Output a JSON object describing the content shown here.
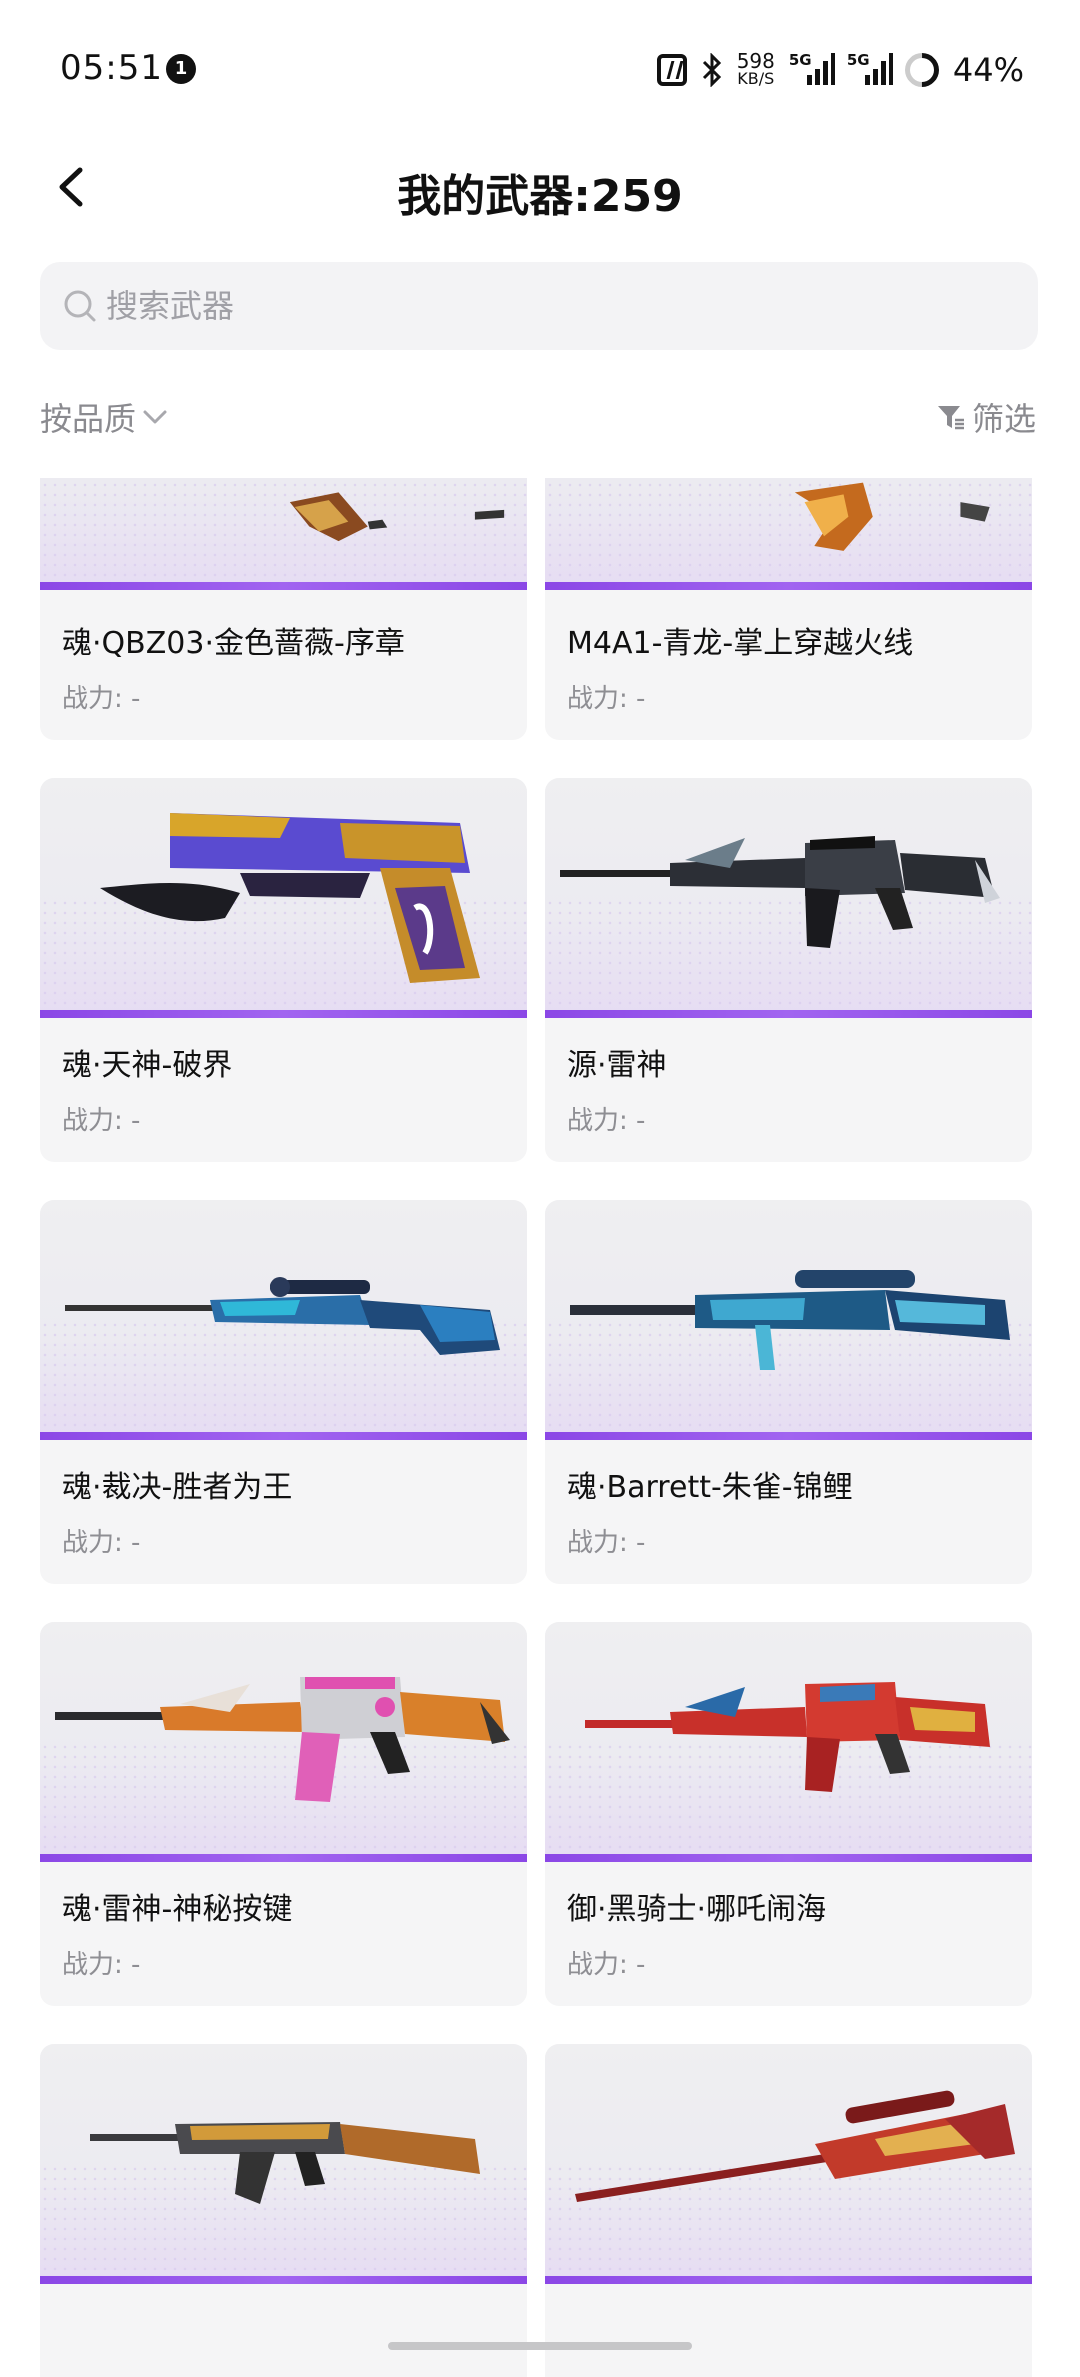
{
  "status_bar": {
    "time": "05:51",
    "notification_count": "1",
    "net_speed_value": "598",
    "net_speed_unit": "KB/S",
    "signal_1_label": "5G",
    "signal_2_label": "5G",
    "battery": "44%"
  },
  "header": {
    "title": "我的武器:259"
  },
  "search": {
    "placeholder": "搜索武器"
  },
  "filters": {
    "sort_label": "按品质",
    "filter_label": "筛选"
  },
  "weapons": [
    {
      "name": "魂·QBZ03·金色蔷薇-序章",
      "power": "战力: -",
      "icon": "rifle-gold-rose"
    },
    {
      "name": "M4A1-青龙-掌上穿越火线",
      "power": "战力: -",
      "icon": "rifle-azure-dragon"
    },
    {
      "name": "魂·天神-破界",
      "power": "战力: -",
      "icon": "pistol-deagle-purple-gold"
    },
    {
      "name": "源·雷神",
      "power": "战力: -",
      "icon": "rifle-m4-thor-black"
    },
    {
      "name": "魂·裁决-胜者为王",
      "power": "战力: -",
      "icon": "sniper-blue"
    },
    {
      "name": "魂·Barrett-朱雀-锦鲤",
      "power": "战力: -",
      "icon": "sniper-barrett-blue"
    },
    {
      "name": "魂·雷神-神秘按键",
      "power": "战力: -",
      "icon": "rifle-m4-pink-orange"
    },
    {
      "name": "御·黑骑士·哪吒闹海",
      "power": "战力: -",
      "icon": "rifle-m4-red"
    },
    {
      "name": "",
      "power": "",
      "icon": "rifle-ak-gold"
    },
    {
      "name": "",
      "power": "",
      "icon": "sniper-red"
    }
  ],
  "colors": {
    "accent": "#8b47e6",
    "card_bg": "#f5f5f6",
    "muted_text": "#8e8e93"
  }
}
